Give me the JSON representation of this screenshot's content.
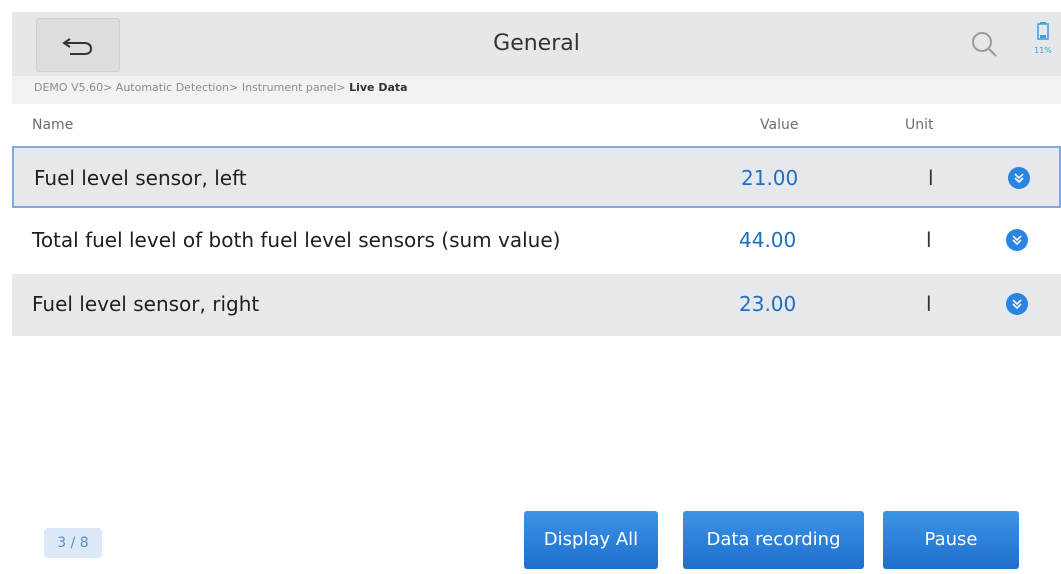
{
  "header": {
    "title": "General",
    "battery_label": "11%"
  },
  "breadcrumb": {
    "path": "DEMO V5.60> Automatic Detection> Instrument panel> ",
    "current": "Live Data"
  },
  "table": {
    "columns": [
      "Name",
      "Value",
      "Unit"
    ],
    "rows": [
      {
        "name": "Fuel level sensor, left",
        "value": "21.00",
        "unit": "l"
      },
      {
        "name": "Total fuel level of both fuel level sensors (sum value)",
        "value": "44.00",
        "unit": "l"
      },
      {
        "name": "Fuel level sensor, right",
        "value": "23.00",
        "unit": "l"
      }
    ]
  },
  "footer": {
    "page_indicator": "3 / 8",
    "display_all_label": "Display All",
    "data_recording_label": "Data recording",
    "pause_label": "Pause"
  },
  "colors": {
    "accent": "#1e6fc1",
    "button": "#2b84e0",
    "header_bg": "#e6e7e9"
  },
  "icons": {
    "back": "back-arrow-icon",
    "search": "search-icon",
    "battery": "battery-icon",
    "expand": "chevron-down-icon"
  }
}
